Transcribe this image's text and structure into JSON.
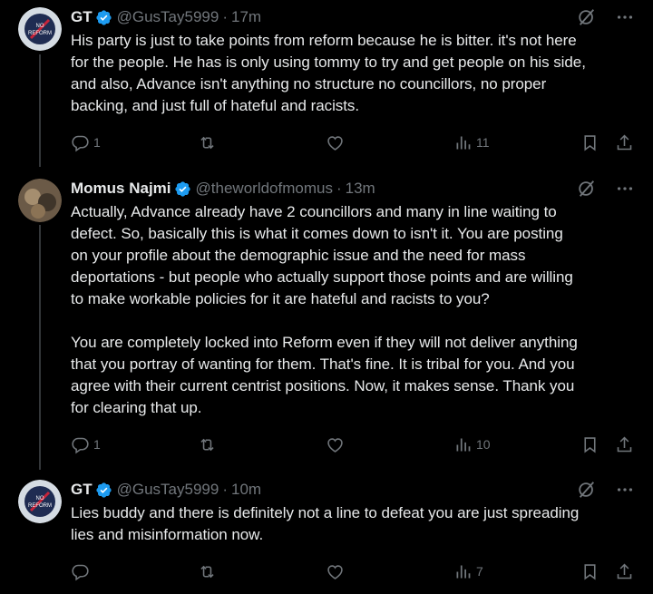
{
  "tweets": [
    {
      "name": "GT",
      "handle": "@GusTay5999",
      "time": "17m",
      "text": "His party is just to take points from reform because he is bitter. it's not here\nfor the people. He has is only using tommy to try and get people on his side,\nand also, Advance isn't anything no structure no councillors, no proper\nbacking, and just full of hateful and racists.",
      "replies": "1",
      "reposts": "",
      "likes": "",
      "views": "11",
      "avatar_text": "NO REFORM"
    },
    {
      "name": "Momus Najmi",
      "handle": "@theworldofmomus",
      "time": "13m",
      "text": "Actually, Advance already have 2 councillors and many in line waiting to\ndefect. So, basically this is what it comes down to isn't it. You are posting\non your profile about the demographic issue and the need for mass\ndeportations - but people who actually support those points and are willing\nto make workable policies for it are hateful and racists to you?\n\nYou are completely locked into Reform even if they will not deliver anything\nthat you portray of wanting for them. That's fine. It is tribal for you. And you\nagree with their current centrist positions. Now, it makes sense. Thank you\nfor clearing that up.",
      "replies": "1",
      "reposts": "",
      "likes": "",
      "views": "10"
    },
    {
      "name": "GT",
      "handle": "@GusTay5999",
      "time": "10m",
      "text": "Lies buddy and there is definitely not a line to defeat you are just spreading\nlies and misinformation now.",
      "replies": "",
      "reposts": "",
      "likes": "",
      "views": "7",
      "avatar_text": "NO REFORM"
    }
  ],
  "colors": {
    "accent": "#1d9bf0",
    "muted": "#71767b",
    "text": "#e7e9ea",
    "line": "#333639"
  }
}
